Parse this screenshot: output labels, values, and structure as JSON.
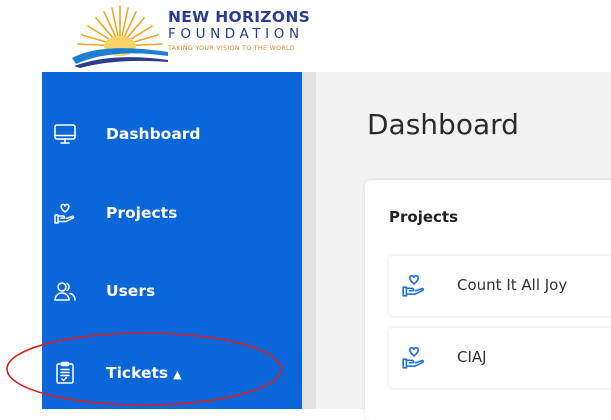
{
  "brand": {
    "title": "NEW HORIZONS",
    "subtitle": "FOUNDATION",
    "tagline": "TAKING YOUR VISION TO THE WORLD"
  },
  "sidebar": {
    "items": [
      {
        "label": "Dashboard",
        "icon": "monitor-icon"
      },
      {
        "label": "Projects",
        "icon": "heart-hand-icon"
      },
      {
        "label": "Users",
        "icon": "users-icon"
      },
      {
        "label": "Tickets",
        "icon": "clipboard-icon",
        "expanded_indicator": "caret-up-icon"
      }
    ]
  },
  "main": {
    "page_title": "Dashboard",
    "projects_card": {
      "title": "Projects",
      "rows": [
        {
          "label": "Count It All Joy",
          "icon": "heart-hand-icon"
        },
        {
          "label": "CIAJ",
          "icon": "heart-hand-icon"
        }
      ]
    }
  },
  "colors": {
    "sidebar_bg": "#0a66d9",
    "brand_navy": "#2a3d8f",
    "brand_orange": "#e08a1e",
    "annotation_red": "#d42020",
    "main_bg": "#f3f3f3"
  }
}
